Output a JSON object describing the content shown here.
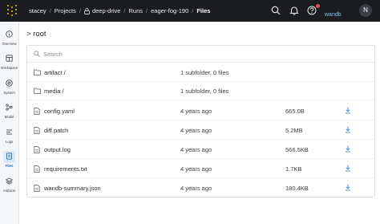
{
  "breadcrumb": {
    "items": [
      "stacey",
      "Projects",
      "deep-drive",
      "Runs",
      "eager-fog-190"
    ],
    "current": "Files"
  },
  "header": {
    "org_label": "wandb",
    "avatar_initial": "N",
    "icons": [
      "search-icon",
      "bell-icon",
      "help-icon"
    ],
    "accent_logo": "#f5c518",
    "badge_color": "#e64a5b"
  },
  "sidebar": {
    "items": [
      {
        "label": "Overview",
        "icon": "info-icon"
      },
      {
        "label": "Workspace",
        "icon": "workspace-icon"
      },
      {
        "label": "System",
        "icon": "system-icon"
      },
      {
        "label": "Model",
        "icon": "model-icon"
      },
      {
        "label": "Logs",
        "icon": "logs-icon"
      },
      {
        "label": "Files",
        "icon": "files-icon",
        "active": true
      },
      {
        "label": "Artifacts",
        "icon": "artifacts-icon"
      }
    ]
  },
  "path": "> root",
  "search": {
    "placeholder": "Search"
  },
  "folders": [
    {
      "name": "artifact /",
      "info": "1 subfolder, 0 files"
    },
    {
      "name": "media /",
      "info": "1 subfolder, 0 files"
    }
  ],
  "files": [
    {
      "name": "config.yaml",
      "modified": "4 years ago",
      "size": "665.0B"
    },
    {
      "name": "diff.patch",
      "modified": "4 years ago",
      "size": "5.2MB"
    },
    {
      "name": "output.log",
      "modified": "4 years ago",
      "size": "566.5KB"
    },
    {
      "name": "requirements.txt",
      "modified": "4 years ago",
      "size": "1.7KB"
    },
    {
      "name": "wandb-summary.json",
      "modified": "4 years ago",
      "size": "180.4KB"
    }
  ]
}
